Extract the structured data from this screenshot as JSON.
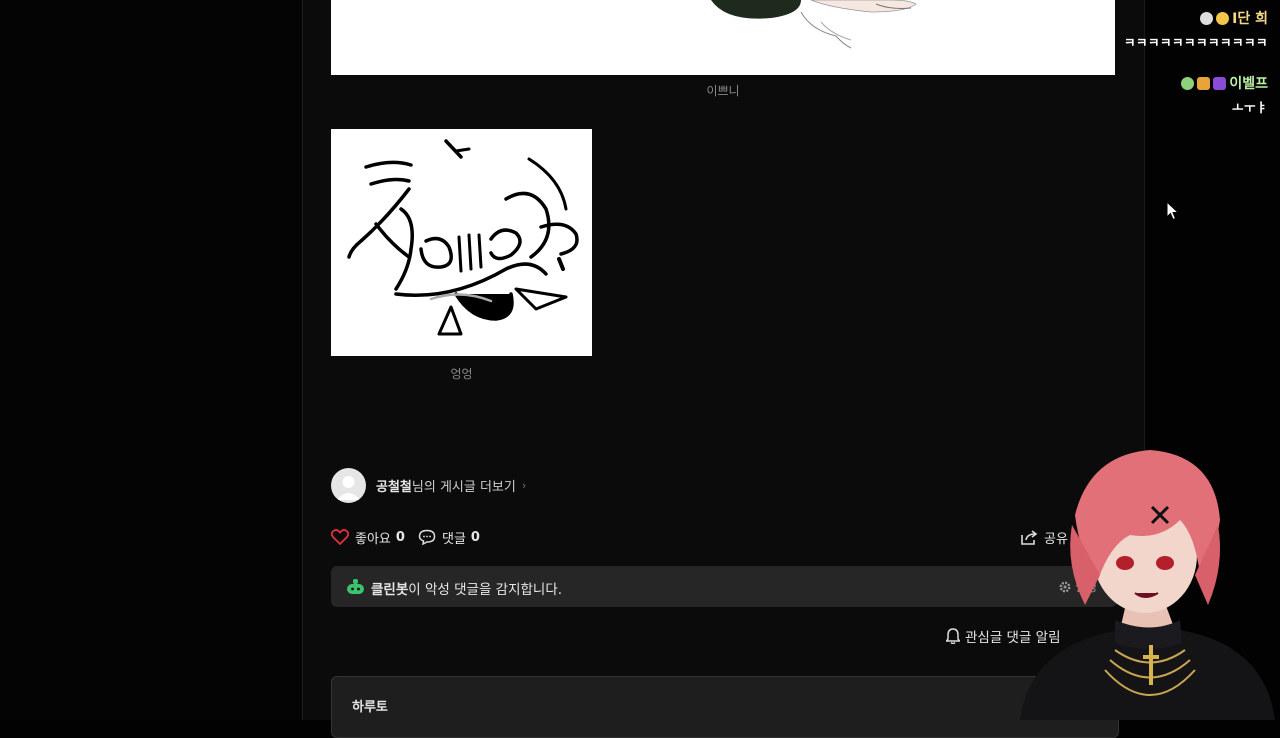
{
  "post": {
    "image1_caption": "이쁘니",
    "image2_caption": "엉엉"
  },
  "author": {
    "name": "공철철",
    "more_posts_suffix": "님의 게시글 더보기"
  },
  "actions": {
    "like_label": "좋아요",
    "like_count": "0",
    "comment_label": "댓글",
    "comment_count": "0",
    "share_label": "공유"
  },
  "cleanbot": {
    "name": "클린봇",
    "message": "이 악성 댓글을 감지합니다.",
    "settings_label": "설정"
  },
  "notify_label": "관심글 댓글 알림",
  "comment_box": {
    "author": "하루토"
  },
  "chat": [
    {
      "username": "I단 희",
      "message": "ㅋㅋㅋㅋㅋㅋㅋㅋㅋㅋㅋㅋ",
      "name_color": "#f3d78a"
    },
    {
      "username": "이벨프",
      "message": "ㅗㅜㅑ",
      "name_color": "#b9f0a3"
    }
  ],
  "colors": {
    "like_heart": "#e0323d",
    "cleanbot_green": "#3cc36b"
  }
}
